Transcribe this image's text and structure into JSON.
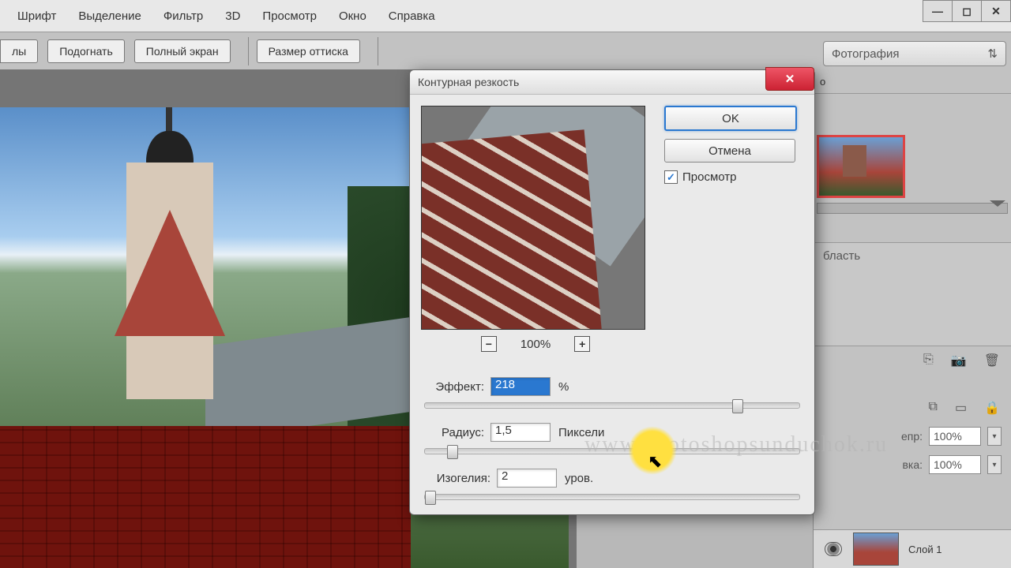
{
  "menu": {
    "items": [
      "Шрифт",
      "Выделение",
      "Фильтр",
      "3D",
      "Просмотр",
      "Окно",
      "Справка"
    ]
  },
  "toolbar": {
    "btn0": "лы",
    "btn1": "Подогнать",
    "btn2": "Полный экран",
    "btn3": "Размер оттиска"
  },
  "workspace": {
    "selected": "Фотография"
  },
  "dialog": {
    "title": "Контурная резкость",
    "ok": "OK",
    "cancel": "Отмена",
    "preview": "Просмотр",
    "zoom": "100%",
    "effect": {
      "label": "Эффект:",
      "value": "218",
      "unit": "%"
    },
    "radius": {
      "label": "Радиус:",
      "value": "1,5",
      "unit": "Пиксели"
    },
    "threshold": {
      "label": "Изогелия:",
      "value": "2",
      "unit": "уров."
    }
  },
  "panels": {
    "tab": "о",
    "region": "бласть",
    "opacity_label": "епр:",
    "opacity": "100%",
    "fill_label": "вка:",
    "fill": "100%",
    "layer": "Слой 1"
  },
  "watermark": "www.photoshopsunduchok.ru"
}
